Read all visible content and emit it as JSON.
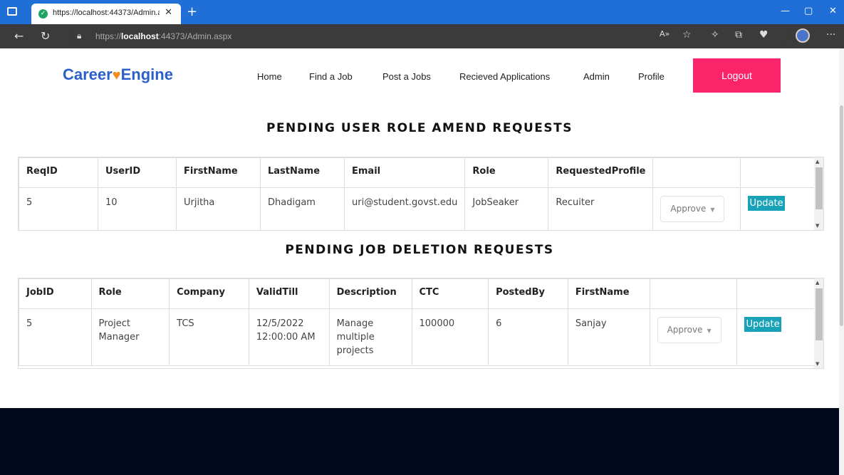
{
  "browser": {
    "tab_title": "https://localhost:44373/Admin.a",
    "url_prefix": "https://",
    "url_host": "localhost",
    "url_rest": ":44373/Admin.aspx"
  },
  "nav": {
    "logo_left": "Career",
    "logo_right": "Engine",
    "items": [
      "Home",
      "Find a Job",
      "Post a Jobs",
      "Recieved Applications",
      "Admin",
      "Profile"
    ],
    "logout": "Logout"
  },
  "role_requests": {
    "title": "PENDING USER ROLE AMEND REQUESTS",
    "headers": [
      "ReqID",
      "UserID",
      "FirstName",
      "LastName",
      "Email",
      "Role",
      "RequestedProfile"
    ],
    "rows": [
      {
        "ReqID": "5",
        "UserID": "10",
        "FirstName": "Urjitha",
        "LastName": "Dhadigam",
        "Email": "uri@student.govst.edu",
        "Role": "JobSeaker",
        "RequestedProfile": "Recuiter",
        "action": "Approve",
        "update": "Update"
      }
    ]
  },
  "job_deletions": {
    "title": "PENDING JOB DELETION REQUESTS",
    "headers": [
      "JobID",
      "Role",
      "Company",
      "ValidTill",
      "Description",
      "CTC",
      "PostedBy",
      "FirstName"
    ],
    "rows": [
      {
        "JobID": "5",
        "Role": "Project Manager",
        "Company": "TCS",
        "ValidTill": "12/5/2022 12:00:00 AM",
        "Description": "Manage multiple projects",
        "CTC": "100000",
        "PostedBy": "6",
        "FirstName": "Sanjay",
        "action": "Approve",
        "update": "Update"
      }
    ]
  },
  "colors": {
    "brand_blue": "#2b5fc9",
    "logout_pink": "#fb246a",
    "update_teal": "#17a2b8",
    "footer_navy": "#010b1d"
  }
}
